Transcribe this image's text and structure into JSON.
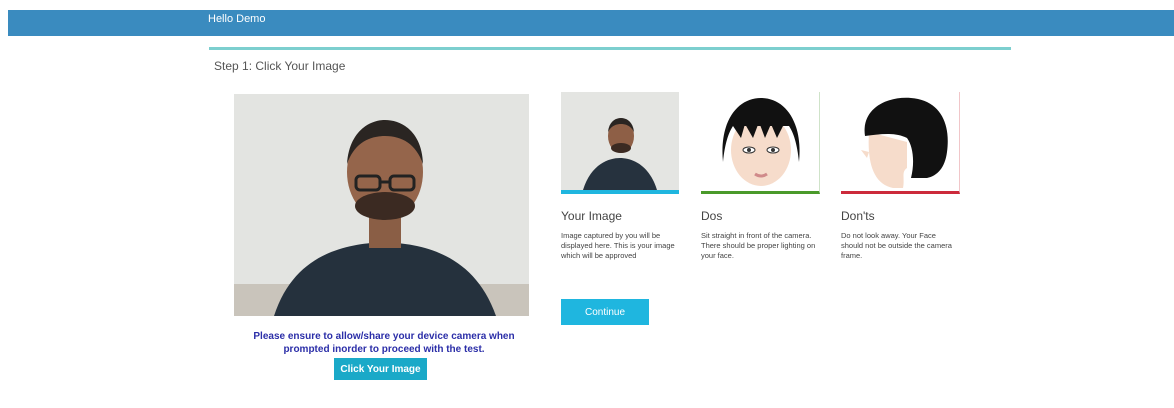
{
  "header": {
    "greeting": "Hello Demo",
    "color": "#3a8bbf"
  },
  "step": {
    "title": "Step 1: Click Your Image"
  },
  "camera": {
    "notice": "Please ensure to allow/share your device camera when prompted inorder to proceed with the test.",
    "button_label": "Click Your Image"
  },
  "cards": [
    {
      "title": "Your Image",
      "description": "Image captured by you will be displayed here. This is your image which will be approved",
      "accent": "#1fb6df"
    },
    {
      "title": "Dos",
      "description": "Sit straight in front of the camera. There should be proper lighting on your face.",
      "accent": "#4a9a2a"
    },
    {
      "title": "Don'ts",
      "description": "Do not look away. Your Face should not be outside the camera frame.",
      "accent": "#cc2a3b"
    }
  ],
  "actions": {
    "continue_label": "Continue"
  }
}
